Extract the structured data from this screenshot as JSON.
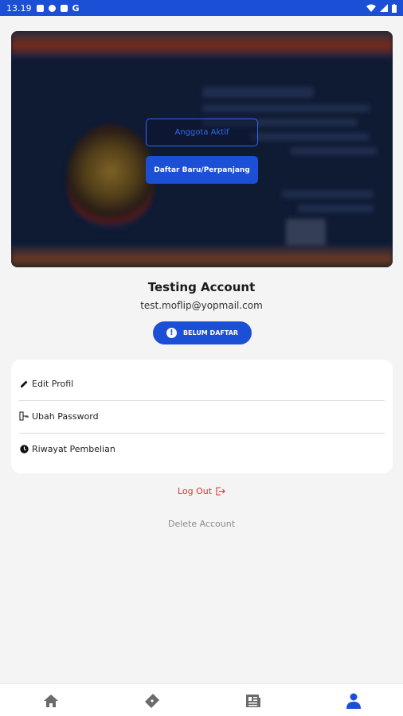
{
  "status_bar": {
    "time": "13.19"
  },
  "card": {
    "active_member_button": "Anggota Aktif",
    "register_button": "Daftar Baru/Perpanjang"
  },
  "profile": {
    "name": "Testing Account",
    "email": "test.moflip@yopmail.com",
    "status_badge": "BELUM DAFTAR"
  },
  "menu": {
    "items": [
      {
        "label": "Edit Profil",
        "icon": "pencil-icon"
      },
      {
        "label": "Ubah Password",
        "icon": "key-icon"
      },
      {
        "label": "Riwayat Pembelian",
        "icon": "clock-icon"
      }
    ]
  },
  "actions": {
    "logout": "Log Out",
    "delete_account": "Delete Account"
  },
  "bottom_nav": {
    "items": [
      {
        "icon": "home-icon",
        "active": false
      },
      {
        "icon": "ticket-icon",
        "active": false
      },
      {
        "icon": "news-icon",
        "active": false
      },
      {
        "icon": "profile-icon",
        "active": true
      }
    ]
  },
  "colors": {
    "accent": "#1a4fd6",
    "logout": "#e03232",
    "inactive_nav": "#6b6b6b"
  }
}
